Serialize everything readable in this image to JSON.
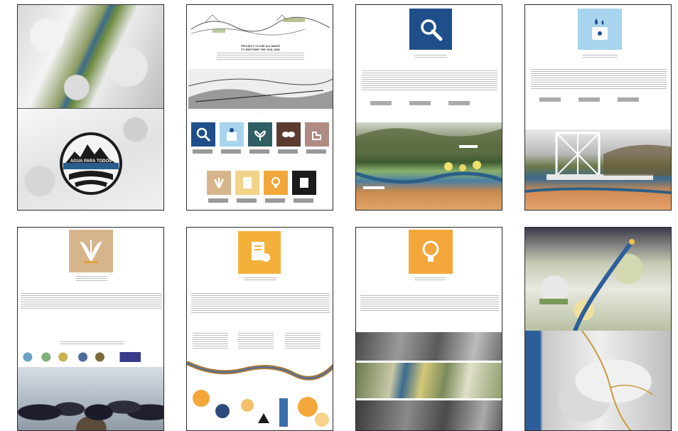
{
  "colors": {
    "frame": "#2a2a2a",
    "navy": "#1f4f8a",
    "light_blue": "#a8d4ee",
    "teal": "#2f5e63",
    "brown": "#5b3a30",
    "dusty_rose": "#b08b84",
    "tan": "#d7b58c",
    "pale_yellow": "#f3d38a",
    "orange": "#f3a73a",
    "black": "#1b1b1b"
  },
  "pages": [
    {
      "id": 1,
      "content": "aerial terrain + circular mountain logo",
      "logo_text": "AGUA PARA TODOS"
    },
    {
      "id": 2,
      "content": "title sketch + icon grid",
      "title_lines": [
        "PROJECT CLOSE ALLIANCE",
        "TO RESTORE THE SOIL AND"
      ]
    },
    {
      "id": 3,
      "content": "navy magnifier icon + landscape section",
      "icon": "magnifier-icon",
      "icon_color": "#1f4f8a"
    },
    {
      "id": 4,
      "content": "light-blue water icon + bridge section",
      "icon": "water-drops-icon",
      "icon_color": "#a8d4ee"
    },
    {
      "id": 5,
      "content": "tan leaf icon + group photo",
      "icon": "leaf-flare-icon",
      "icon_color": "#d7b58c"
    },
    {
      "id": 6,
      "content": "orange document icon + river illustration",
      "icon": "document-icon",
      "icon_color": "#f3b13a"
    },
    {
      "id": 7,
      "content": "orange lightbulb icon + aerial strips",
      "icon": "lightbulb-icon",
      "icon_color": "#f3a73a"
    },
    {
      "id": 8,
      "content": "aerial river + map",
      "icon": "none"
    }
  ],
  "icon_grid": [
    "magnifier-icon",
    "water-icon",
    "sprout-icon",
    "handshake-icon",
    "hand-icon",
    "leaf-flare-icon",
    "document-icon",
    "lightbulb-icon",
    "frame-icon"
  ]
}
